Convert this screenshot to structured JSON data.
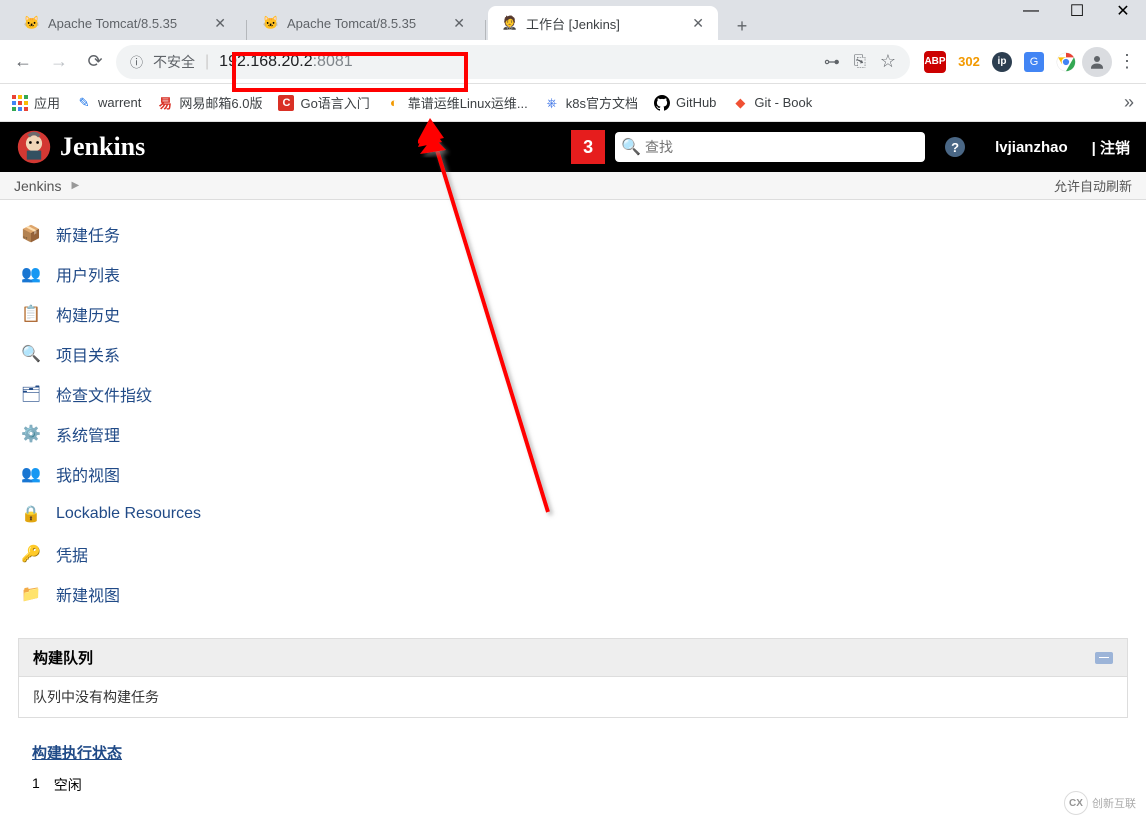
{
  "window": {
    "minimize": "—",
    "maximize": "☐",
    "close": "✕"
  },
  "tabs": [
    {
      "title": "Apache Tomcat/8.5.35",
      "active": false
    },
    {
      "title": "Apache Tomcat/8.5.35",
      "active": false
    },
    {
      "title": "工作台 [Jenkins]",
      "active": true
    }
  ],
  "addressbar": {
    "not_secure": "不安全",
    "url_host": "192.168.20.2",
    "url_port": ":8081"
  },
  "toolbar_badges": {
    "abp": "ABP",
    "count": "302",
    "ip": "ip"
  },
  "bookmarks": {
    "apps": "应用",
    "items": [
      {
        "label": "warrent",
        "color": "#1a73e8",
        "glyph": "✎"
      },
      {
        "label": "网易邮箱6.0版",
        "color": "#d93025",
        "glyph": "易"
      },
      {
        "label": "Go语言入门",
        "color": "#d93025",
        "glyph": "C"
      },
      {
        "label": "靠谱运维Linux运维...",
        "color": "#f29900",
        "glyph": "◐"
      },
      {
        "label": "k8s官方文档",
        "color": "#326ce5",
        "glyph": "⎈"
      },
      {
        "label": "GitHub",
        "color": "#000",
        "glyph": "⊙"
      },
      {
        "label": "Git - Book",
        "color": "#f05033",
        "glyph": "◆"
      }
    ]
  },
  "jenkins": {
    "name": "Jenkins",
    "notif_count": "3",
    "search_placeholder": "查找",
    "username": "lvjianzhao",
    "logout": "| 注销"
  },
  "breadcrumb": {
    "root": "Jenkins",
    "auto_refresh": "允许自动刷新"
  },
  "sidebar": {
    "items": [
      {
        "label": "新建任务",
        "icon": "📦",
        "color": "#e8a33d"
      },
      {
        "label": "用户列表",
        "icon": "👥",
        "color": "#4a90d9"
      },
      {
        "label": "构建历史",
        "icon": "📋",
        "color": "#c09553"
      },
      {
        "label": "项目关系",
        "icon": "🔍",
        "color": "#888"
      },
      {
        "label": "检查文件指纹",
        "icon": "🗂",
        "color": "#888"
      },
      {
        "label": "系统管理",
        "icon": "⚙",
        "color": "#888"
      },
      {
        "label": "我的视图",
        "icon": "👥",
        "color": "#4a90d9"
      },
      {
        "label": "Lockable Resources",
        "icon": "🔒",
        "color": "#888"
      },
      {
        "label": "凭据",
        "icon": "🔑",
        "color": "#d4a017"
      },
      {
        "label": "新建视图",
        "icon": "📁",
        "color": "#6fa8dc"
      }
    ]
  },
  "build_queue": {
    "title": "构建队列",
    "empty": "队列中没有构建任务"
  },
  "executor": {
    "title": "构建执行状态",
    "row_num": "1",
    "row_status": "空闲"
  },
  "watermark": "创新互联"
}
